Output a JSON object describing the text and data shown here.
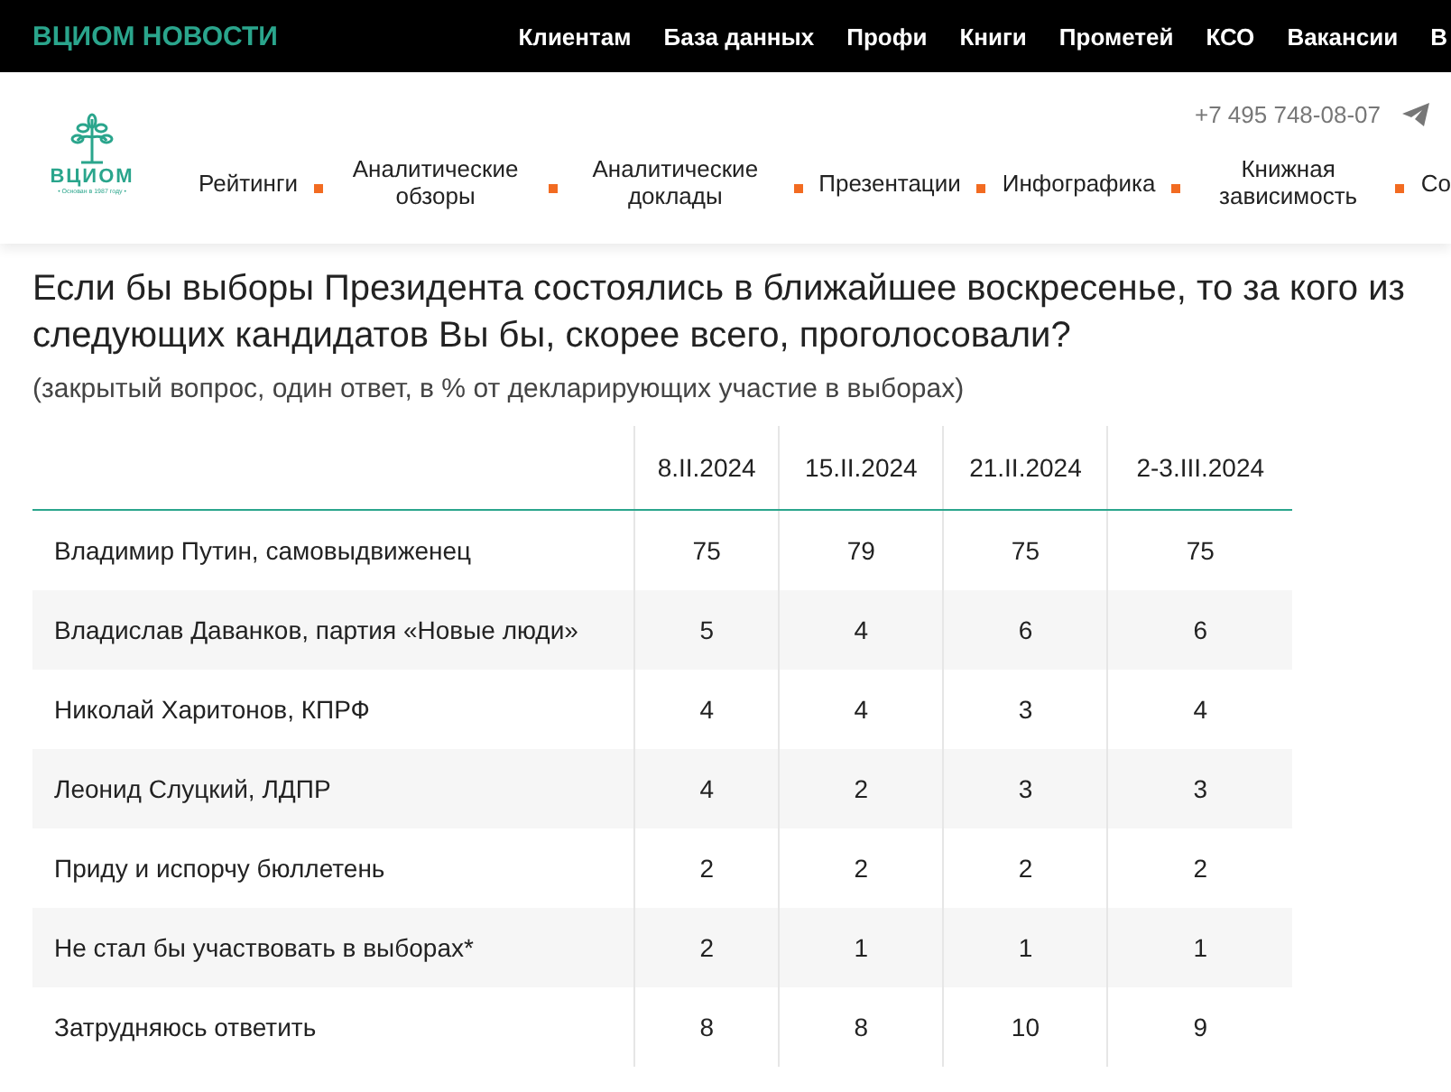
{
  "top_bar": {
    "brand": "ВЦИОМ НОВОСТИ",
    "links": [
      "Клиентам",
      "База данных",
      "Профи",
      "Книги",
      "Прометей",
      "КСО",
      "Вакансии",
      "В"
    ]
  },
  "header": {
    "logo": {
      "name": "ВЦИОМ",
      "tagline": "• Основан в 1987 году •"
    },
    "phone": "+7 495 748-08-07",
    "nav": [
      "Рейтинги",
      "Аналитические обзоры",
      "Аналитические доклады",
      "Презентации",
      "Инфографика",
      "Книжная зависимость",
      "Со"
    ]
  },
  "question": {
    "title": "Если бы выборы Президента состоялись в ближайшее воскресенье, то за кого из следующих кандидатов Вы бы, скорее всего, проголосовали?",
    "note": "(закрытый вопрос, один ответ, в % от декларирующих участие в выборах)"
  },
  "table": {
    "columns": [
      "8.II.2024",
      "15.II.2024",
      "21.II.2024",
      "2-3.III.2024"
    ],
    "rows": [
      {
        "label": "Владимир Путин, самовыдвиженец",
        "values": [
          "75",
          "79",
          "75",
          "75"
        ]
      },
      {
        "label": "Владислав Даванков, партия «Новые люди»",
        "values": [
          "5",
          "4",
          "6",
          "6"
        ]
      },
      {
        "label": "Николай Харитонов, КПРФ",
        "values": [
          "4",
          "4",
          "3",
          "4"
        ]
      },
      {
        "label": "Леонид Слуцкий, ЛДПР",
        "values": [
          "4",
          "2",
          "3",
          "3"
        ]
      },
      {
        "label": "Приду и испорчу бюллетень",
        "values": [
          "2",
          "2",
          "2",
          "2"
        ]
      },
      {
        "label": "Не стал бы участвовать в выборах*",
        "values": [
          "2",
          "1",
          "1",
          "1"
        ]
      },
      {
        "label": "Затрудняюсь ответить",
        "values": [
          "8",
          "8",
          "10",
          "9"
        ]
      }
    ]
  }
}
